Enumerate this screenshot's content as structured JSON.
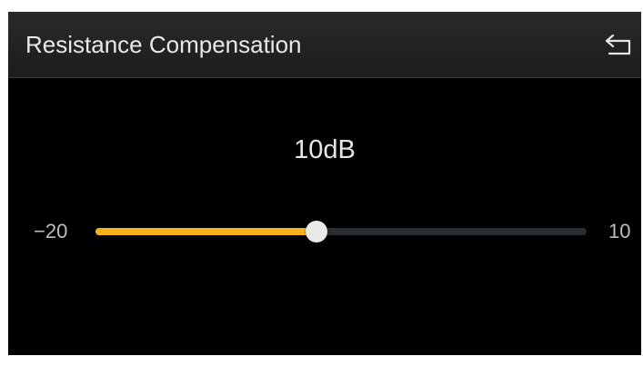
{
  "header": {
    "title": "Resistance Compensation",
    "back_icon": "back-arrow-icon"
  },
  "slider": {
    "value_text": "10dB",
    "min_label": "−20",
    "max_label": "10",
    "fill_fraction": 0.45,
    "fill_color": "#f6b11c",
    "track_color": "#2a2e31",
    "thumb_color": "#e8e8e8"
  }
}
